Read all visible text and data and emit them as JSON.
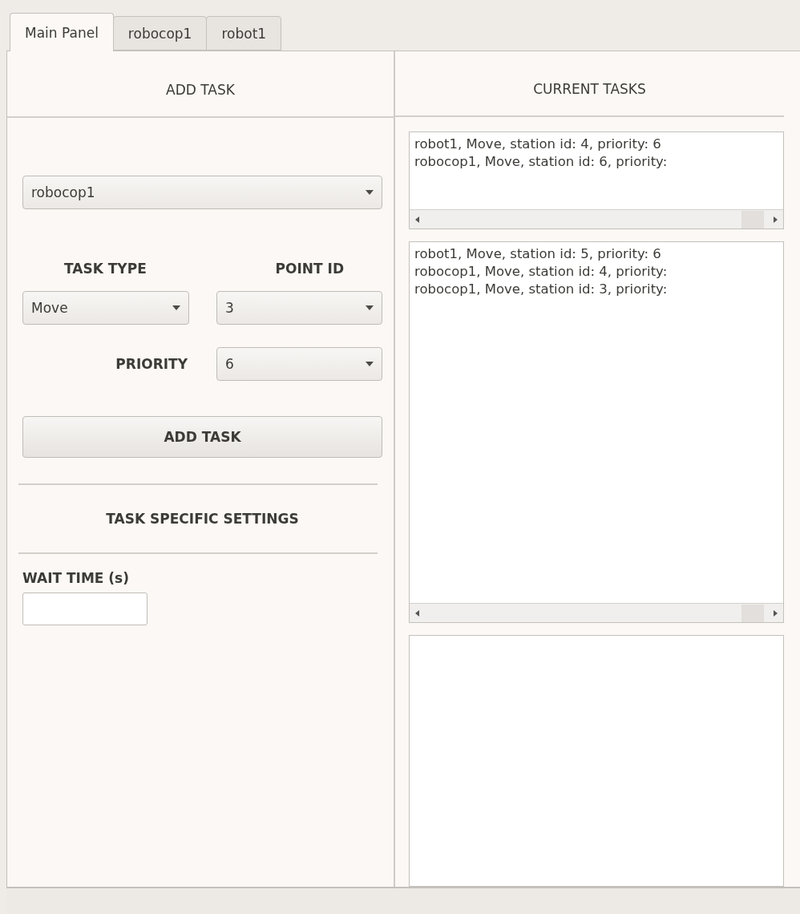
{
  "tabs": [
    {
      "label": "Main Panel",
      "selected": true
    },
    {
      "label": "robocop1",
      "selected": false
    },
    {
      "label": "robot1",
      "selected": false
    }
  ],
  "add_task": {
    "title": "ADD TASK",
    "robot_select": {
      "value": "robocop1"
    },
    "task_type": {
      "label": "TASK TYPE",
      "value": "Move"
    },
    "point_id": {
      "label": "POINT ID",
      "value": "3"
    },
    "priority": {
      "label": "PRIORITY",
      "value": "6"
    },
    "button": "ADD TASK",
    "settings_title": "TASK SPECIFIC SETTINGS",
    "wait_time": {
      "label": "WAIT TIME (s)"
    }
  },
  "current_tasks": {
    "title": "CURRENT TASKS",
    "lists": [
      {
        "items": [
          "robot1, Move, station id: 4, priority: 6",
          "robocop1, Move, station id: 6, priority:"
        ],
        "scrollbar": true
      },
      {
        "items": [
          "robot1, Move, station id: 5, priority: 6",
          "robocop1, Move, station id: 4, priority:",
          "robocop1, Move, station id: 3, priority:"
        ],
        "scrollbar": true
      },
      {
        "scrollbar": false
      }
    ]
  }
}
